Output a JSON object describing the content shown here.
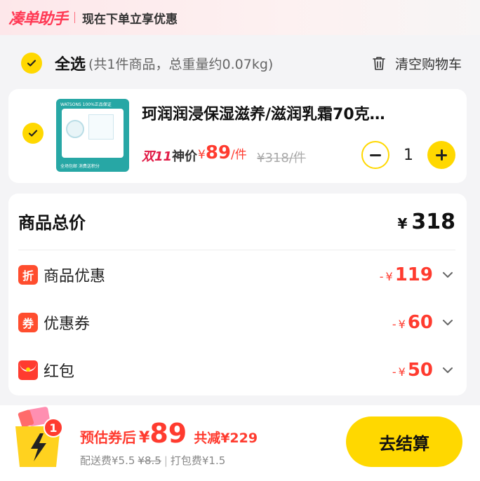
{
  "header": {
    "brand": "凑单助手",
    "slogan": "现在下单立享优惠"
  },
  "select_all": {
    "label": "全选",
    "summary": "(共1件商品，总重量约0.07kg)",
    "clear_label": "清空购物车"
  },
  "cart_item": {
    "checked": true,
    "title": "珂润润浸保湿滋养/滋润乳霜70克…",
    "thumb_top_text": "WATSONS  100%正品保证",
    "thumb_bottom_text": "全场包邮  消费送积分",
    "promo_tag": "双11",
    "promo_tag_sub": "神价",
    "price_currency": "¥",
    "price": "89",
    "price_unit": "/件",
    "original_price": "¥318/件",
    "quantity": "1"
  },
  "summary": {
    "total_label": "商品总价",
    "total_currency": "¥",
    "total_value": "318",
    "rows": [
      {
        "icon": "折",
        "name": "商品优惠",
        "prefix": "-",
        "currency": "¥",
        "value": "119"
      },
      {
        "icon": "券",
        "name": "优惠券",
        "prefix": "-",
        "currency": "¥",
        "value": "60"
      },
      {
        "icon": "",
        "name": "红包",
        "prefix": "-",
        "currency": "¥",
        "value": "50"
      }
    ]
  },
  "footer": {
    "badge_count": "1",
    "estimate_label": "预估券后",
    "estimate_currency": "¥",
    "estimate_value": "89",
    "total_saved": "共减¥229",
    "shipping_label": "配送费¥5.5",
    "shipping_original": "¥8.5",
    "packing_fee": "打包费¥1.5",
    "checkout_label": "去结算"
  },
  "colors": {
    "accent_yellow": "#ffd800",
    "price_red": "#ff3b2f",
    "brand_pink": "#ff3a55"
  }
}
